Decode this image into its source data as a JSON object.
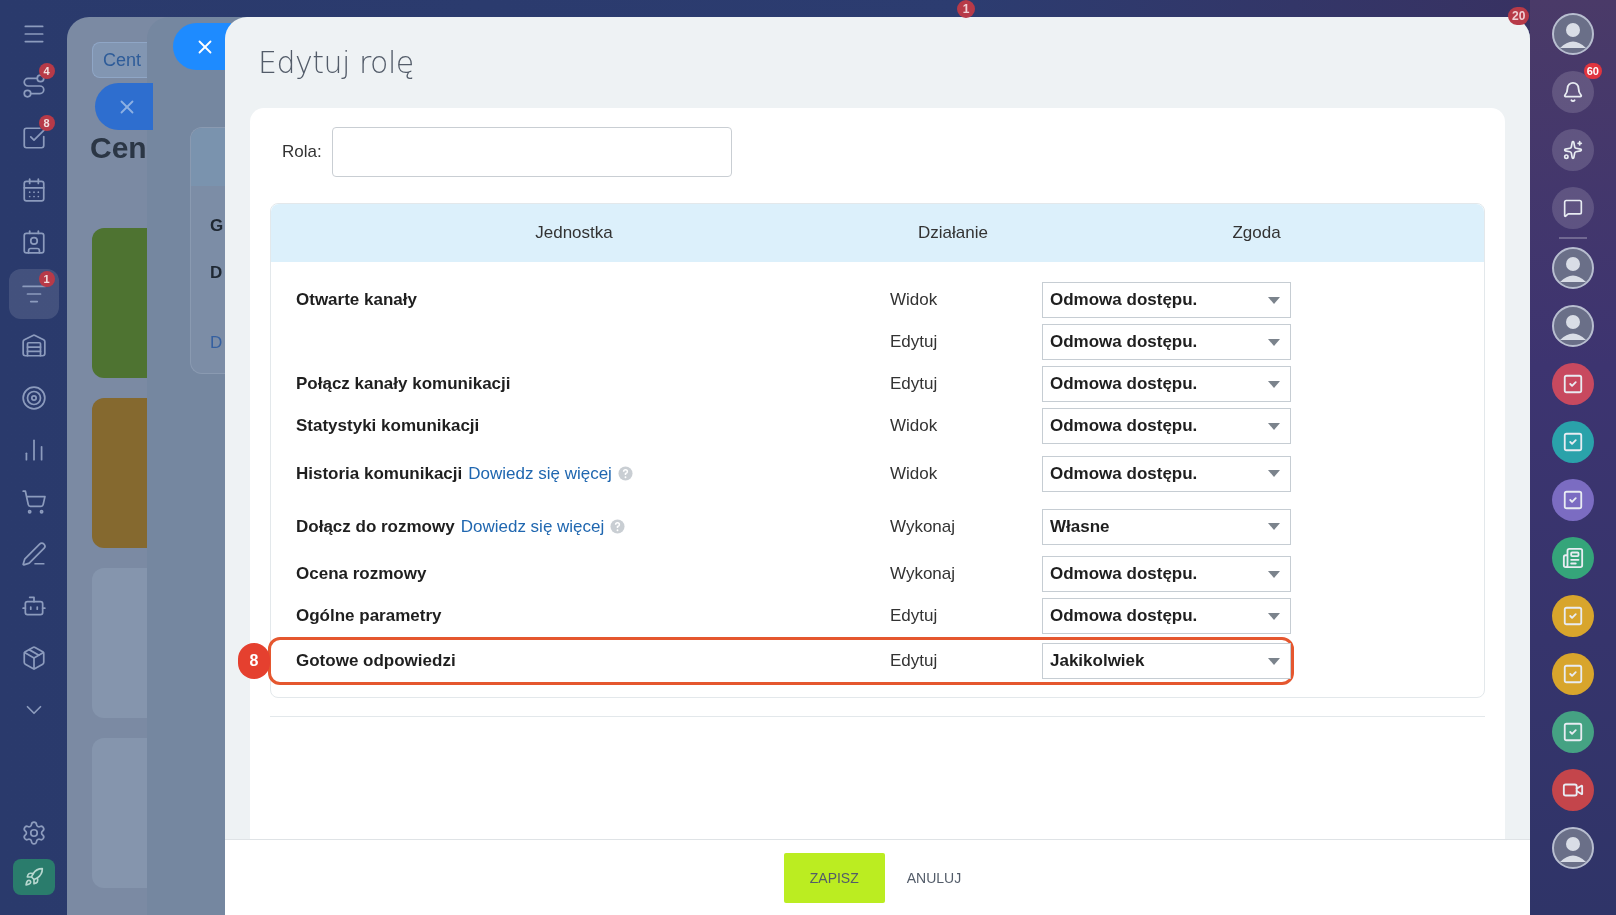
{
  "left_sidebar": {
    "items": [
      {
        "kind": "menu",
        "selected": false
      },
      {
        "kind": "route",
        "badge": "4",
        "selected": false
      },
      {
        "kind": "tasks",
        "badge": "8",
        "selected": false
      },
      {
        "kind": "calendar",
        "selected": false
      },
      {
        "kind": "contacts",
        "selected": false
      },
      {
        "kind": "funnel",
        "badge": "1",
        "selected": true
      },
      {
        "kind": "warehouse",
        "selected": false
      },
      {
        "kind": "target",
        "selected": false
      },
      {
        "kind": "chart",
        "selected": false
      },
      {
        "kind": "cart",
        "selected": false
      },
      {
        "kind": "pen",
        "selected": false
      },
      {
        "kind": "robot",
        "selected": false
      },
      {
        "kind": "box",
        "selected": false
      },
      {
        "kind": "more",
        "selected": false
      },
      {
        "kind": "settings",
        "selected": false
      },
      {
        "kind": "rocket",
        "selected": false
      }
    ]
  },
  "top_badges": [
    "1",
    "20"
  ],
  "background_panel": {
    "tab_label": "Cent",
    "heading": "Cen"
  },
  "background_card": {
    "lines": [
      "G",
      "D"
    ],
    "link": "D"
  },
  "modal": {
    "title": "Edytuj rolę",
    "role_label": "Rola:",
    "columns": [
      "Jednostka",
      "Działanie",
      "Zgoda"
    ],
    "rows": [
      {
        "entity": "Otwarte kanały",
        "action": "Widok",
        "permission": "Odmowa dostępu.",
        "highlighted": false
      },
      {
        "action": "Edytuj",
        "permission": "Odmowa dostępu.",
        "highlighted": false
      },
      {
        "entity": "Połącz kanały komunikacji",
        "action": "Edytuj",
        "permission": "Odmowa dostępu.",
        "highlighted": false
      },
      {
        "entity": "Statystyki komunikacji",
        "action": "Widok",
        "permission": "Odmowa dostępu.",
        "highlighted": false
      },
      {
        "entity": "Historia komunikacji",
        "link": "Dowiedz się więcej",
        "help": true,
        "action": "Widok",
        "permission": "Odmowa dostępu.",
        "highlighted": false
      },
      {
        "entity": "Dołącz do rozmowy",
        "link": "Dowiedz się więcej",
        "help": true,
        "action": "Wykonaj",
        "permission": "Własne",
        "highlighted": false
      },
      {
        "entity": "Ocena rozmowy",
        "action": "Wykonaj",
        "permission": "Odmowa dostępu.",
        "highlighted": false
      },
      {
        "entity": "Ogólne parametry",
        "action": "Edytuj",
        "permission": "Odmowa dostępu.",
        "highlighted": false
      },
      {
        "entity": "Gotowe odpowiedzi",
        "action": "Edytuj",
        "permission": "Jakikolwiek",
        "highlighted": true,
        "marker": "8"
      }
    ],
    "save_button": "ZAPISZ",
    "cancel_button": "ANULUJ"
  },
  "right_sidebar": {
    "items": [
      {
        "kind": "avatar"
      },
      {
        "kind": "bell",
        "badge": "60"
      },
      {
        "kind": "copilot"
      },
      {
        "kind": "chat"
      },
      {
        "kind": "divider"
      },
      {
        "kind": "avatar"
      },
      {
        "kind": "avatar"
      },
      {
        "kind": "task",
        "color": "#c8495f"
      },
      {
        "kind": "task",
        "color": "#2aa2aa"
      },
      {
        "kind": "task",
        "color": "#7b6cc2"
      },
      {
        "kind": "news",
        "color": "#35a57a"
      },
      {
        "kind": "task",
        "color": "#d8a52c"
      },
      {
        "kind": "task",
        "color": "#d8a52c"
      },
      {
        "kind": "task",
        "color": "#45a283"
      },
      {
        "kind": "video",
        "color": "#c4454b"
      },
      {
        "kind": "avatar"
      }
    ]
  }
}
